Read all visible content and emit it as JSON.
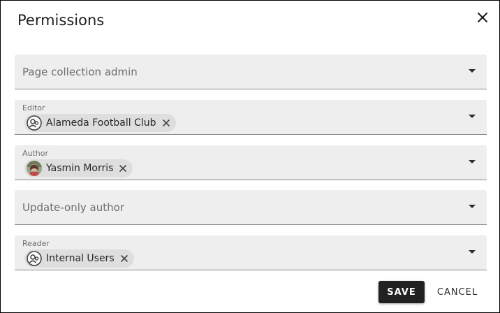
{
  "dialog": {
    "title": "Permissions",
    "close_icon": "close-icon"
  },
  "fields": {
    "page_collection_admin": {
      "placeholder": "Page collection admin"
    },
    "editor": {
      "label": "Editor",
      "chip": {
        "text": "Alameda Football Club",
        "avatar": "group-icon"
      }
    },
    "author": {
      "label": "Author",
      "chip": {
        "text": "Yasmin Morris",
        "avatar": "user-photo"
      }
    },
    "update_only_author": {
      "placeholder": "Update-only author"
    },
    "reader": {
      "label": "Reader",
      "chip": {
        "text": "Internal Users",
        "avatar": "group-icon"
      }
    }
  },
  "actions": {
    "save_label": "SAVE",
    "cancel_label": "CANCEL"
  },
  "colors": {
    "field_bg": "#eeeeee",
    "chip_bg": "#dedede",
    "primary_button": "#212121"
  }
}
